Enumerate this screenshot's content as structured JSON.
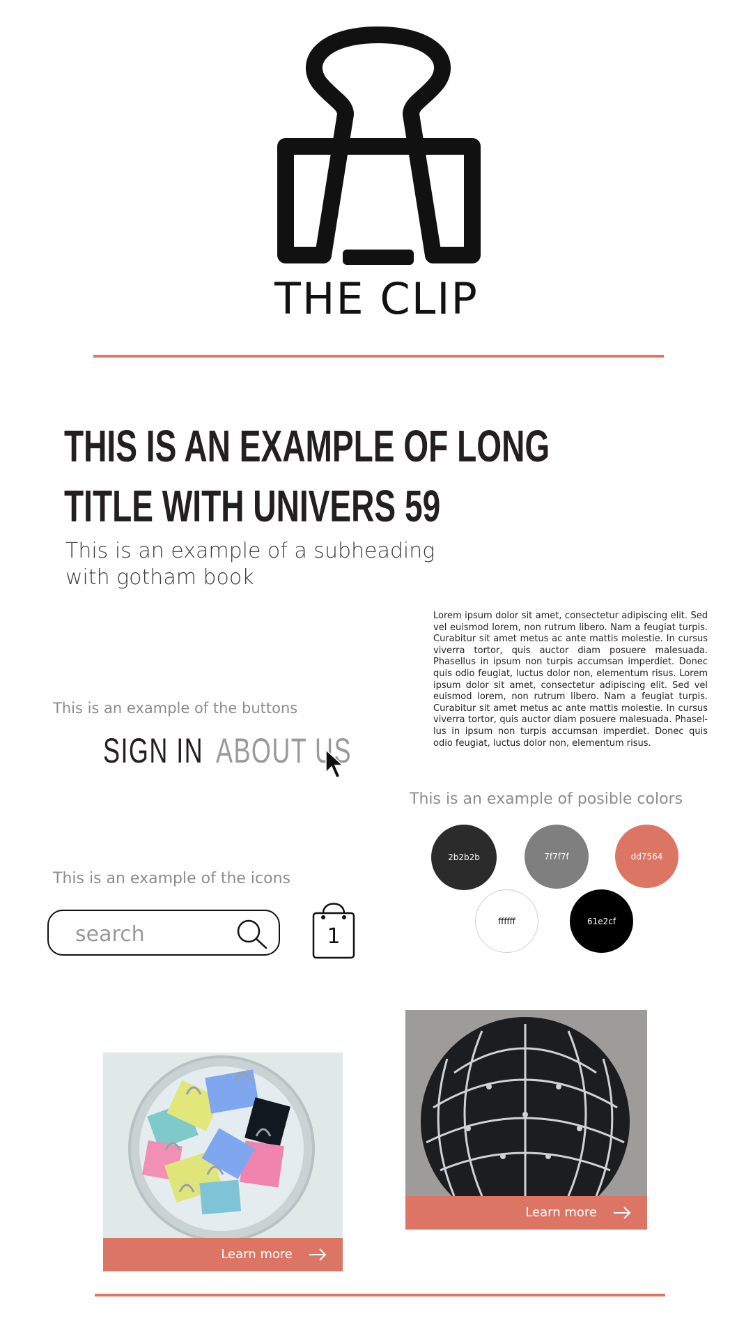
{
  "logo": {
    "text": "THE CLIP"
  },
  "typography": {
    "title_line1": "THIS IS AN EXAMPLE OF LONG",
    "title_line2": "TITLE WITH UNIVERS 59",
    "subheading_line1": "This is an example of a subheading",
    "subheading_line2": "with gotham book",
    "body_text": "Lorem ipsum dolor sit amet, consectetur adipiscing elit. Sed vel euismod lorem, non rutrum libero. Nam a feugiat turpis. Curabitur sit amet metus ac ante mattis molestie. In cursus viverra tortor, quis auctor diam posuere malesuada. Phasellus in ipsum non turpis accumsan imperdiet. Donec quis odio feugiat, luctus dolor non, elementum risus. Lorem ipsum dolor sit amet, consectetur adipiscing elit. Sed vel euismod lorem, non rutrum libero. Nam a feugiat turpis. Curabitur sit amet metus ac ante mattis molestie. In cursus viverra tortor, quis auctor diam posuere malesuada. Phasel-lus in ipsum non turpis accumsan imperdiet. Donec quis odio feugiat, luctus dolor non, elementum risus."
  },
  "buttons": {
    "caption": "This is an example of the buttons",
    "sign_in": "SIGN IN",
    "about_us": "ABOUT US"
  },
  "colors": {
    "caption": "This is an example of posible colors",
    "swatches": [
      {
        "label": "2b2b2b",
        "hex": "#2b2b2b"
      },
      {
        "label": "7f7f7f",
        "hex": "#7f7f7f"
      },
      {
        "label": "dd7564",
        "hex": "#dd7564"
      },
      {
        "label": "ffffff",
        "hex": "#ffffff"
      },
      {
        "label": "61e2cf",
        "hex": "#000000"
      }
    ]
  },
  "icons": {
    "caption": "This is an example of the icons",
    "search_placeholder": "search",
    "cart_count": "1",
    "names": [
      "search-icon",
      "shopping-bag-icon",
      "arrow-right-icon",
      "cursor-icon"
    ]
  },
  "cards": [
    {
      "cta": "Learn more",
      "image": "bowl of colorful binder clips"
    },
    {
      "cta": "Learn more",
      "image": "sphere made of binder clips"
    }
  ]
}
